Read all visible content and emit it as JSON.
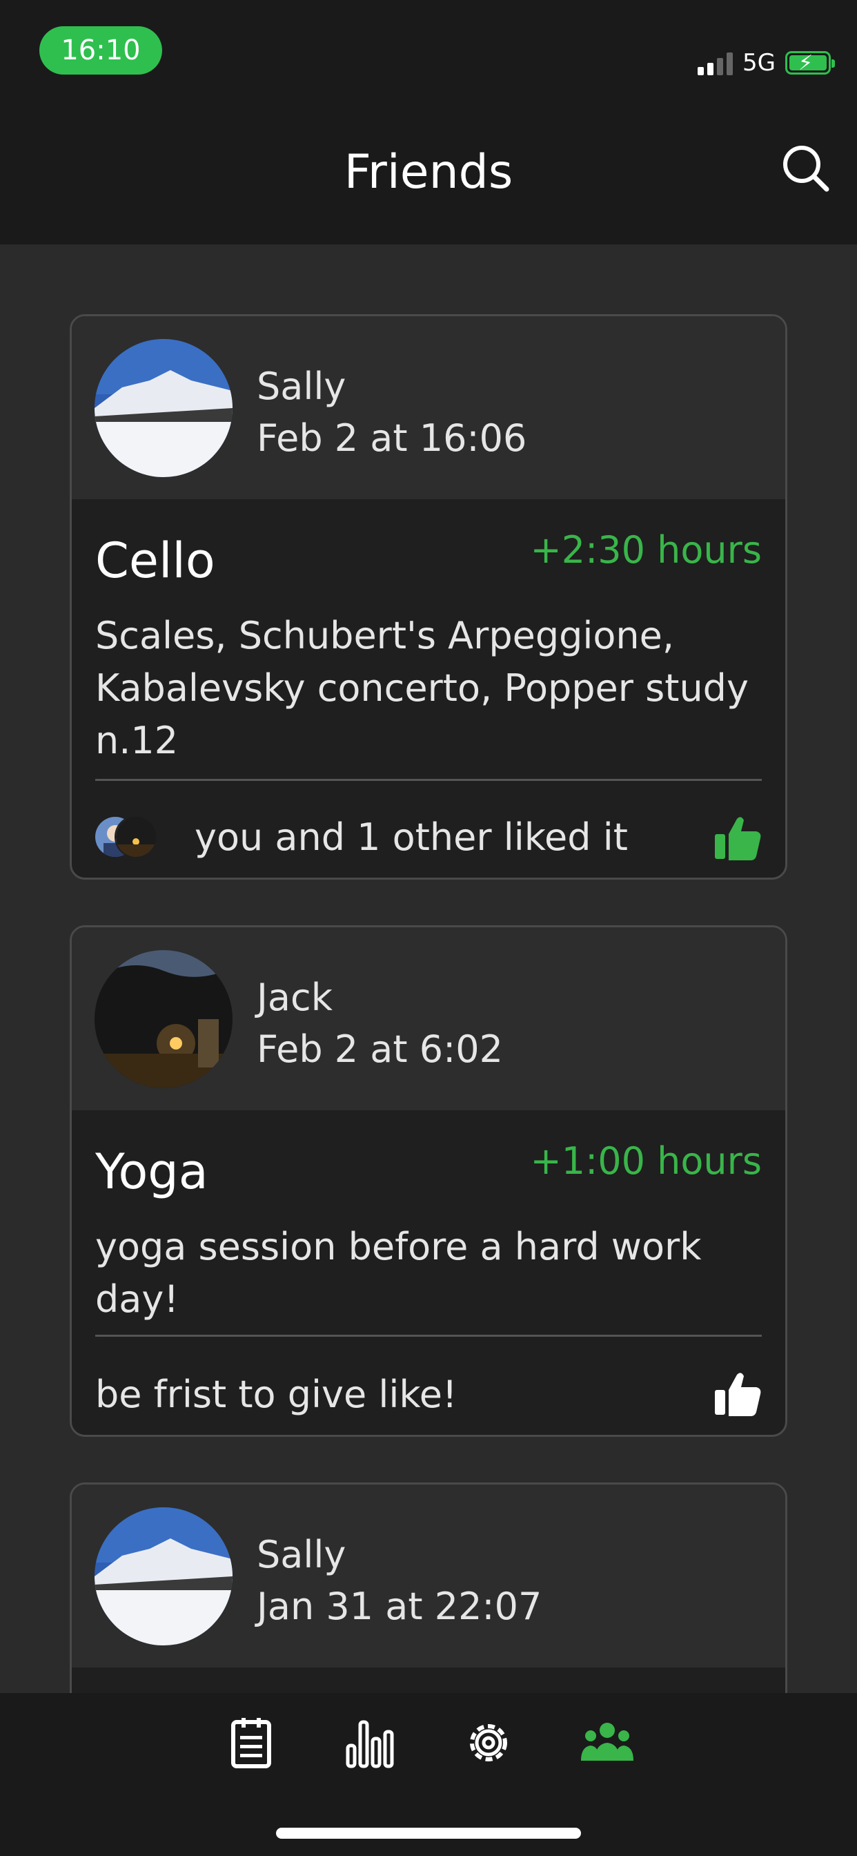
{
  "status_bar": {
    "time": "16:10",
    "network": "5G"
  },
  "header": {
    "title": "Friends"
  },
  "posts": [
    {
      "user": "Sally",
      "date": "Feb 2 at 16:06",
      "activity": "Cello",
      "hours": "+2:30 hours",
      "notes": "Scales, Schubert's Arpeggione, Kabalevsky concerto, Popper study n.12",
      "likes_text": "you and 1 other liked it",
      "liked": true
    },
    {
      "user": "Jack",
      "date": "Feb 2 at 6:02",
      "activity": "Yoga",
      "hours": "+1:00 hours",
      "notes": "yoga session before a hard work day!",
      "likes_text": "be frist to give like!",
      "liked": false
    },
    {
      "user": "Sally",
      "date": "Jan 31 at 22:07"
    }
  ],
  "colors": {
    "accent": "#39b54a",
    "background": "#2b2b2b",
    "card": "#1f1f1f",
    "card_header": "#2d2d2d",
    "bar": "#1a1a1a"
  },
  "nav": {
    "items": [
      {
        "icon": "notepad-icon",
        "active": false
      },
      {
        "icon": "bar-chart-icon",
        "active": false
      },
      {
        "icon": "gear-icon",
        "active": false
      },
      {
        "icon": "friends-icon",
        "active": true
      }
    ]
  }
}
